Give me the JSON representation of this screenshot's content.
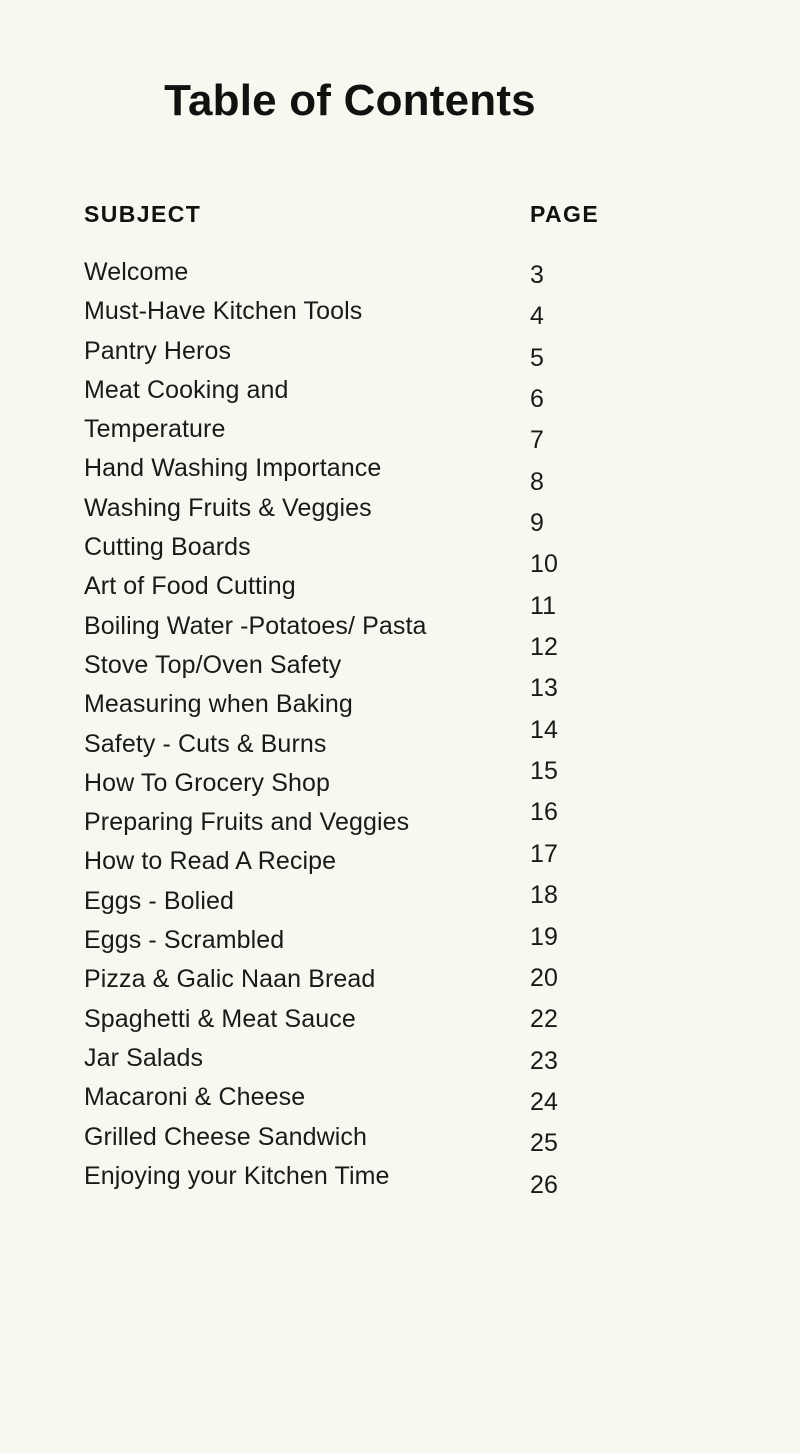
{
  "document": {
    "title": "Table of Contents",
    "background_color": "#f8f8f0",
    "text_color": "#1a1a18"
  },
  "table_of_contents": {
    "headers": {
      "subject": "SUBJECT",
      "page": "PAGE"
    },
    "entries": [
      {
        "subject": "Welcome",
        "page": "3"
      },
      {
        "subject": "Must-Have Kitchen Tools",
        "page": "4"
      },
      {
        "subject": "Pantry Heros",
        "page": "5"
      },
      {
        "subject": "Meat Cooking and",
        "page": "6"
      },
      {
        "subject": "Temperature",
        "page": "7"
      },
      {
        "subject": "Hand Washing Importance",
        "page": "8"
      },
      {
        "subject": "Washing Fruits & Veggies",
        "page": "9"
      },
      {
        "subject": "Cutting Boards",
        "page": "10"
      },
      {
        "subject": "Art of Food Cutting",
        "page": "11"
      },
      {
        "subject": "Boiling Water -Potatoes/ Pasta",
        "page": "12"
      },
      {
        "subject": "Stove Top/Oven Safety",
        "page": "13"
      },
      {
        "subject": "Measuring when Baking",
        "page": "14"
      },
      {
        "subject": "Safety - Cuts & Burns",
        "page": "15"
      },
      {
        "subject": "How To Grocery Shop",
        "page": "16"
      },
      {
        "subject": "Preparing Fruits and Veggies",
        "page": "17"
      },
      {
        "subject": "How to Read A Recipe",
        "page": "18"
      },
      {
        "subject": "Eggs - Bolied",
        "page": "19"
      },
      {
        "subject": "Eggs - Scrambled",
        "page": "20"
      },
      {
        "subject": "Pizza & Galic Naan Bread",
        "page": "22"
      },
      {
        "subject": "Spaghetti & Meat Sauce",
        "page": "23"
      },
      {
        "subject": "Jar Salads",
        "page": "24"
      },
      {
        "subject": "Macaroni & Cheese",
        "page": "25"
      },
      {
        "subject": "Grilled Cheese Sandwich",
        "page": "26"
      },
      {
        "subject": "Enjoying your Kitchen Time",
        "page": ""
      }
    ]
  }
}
